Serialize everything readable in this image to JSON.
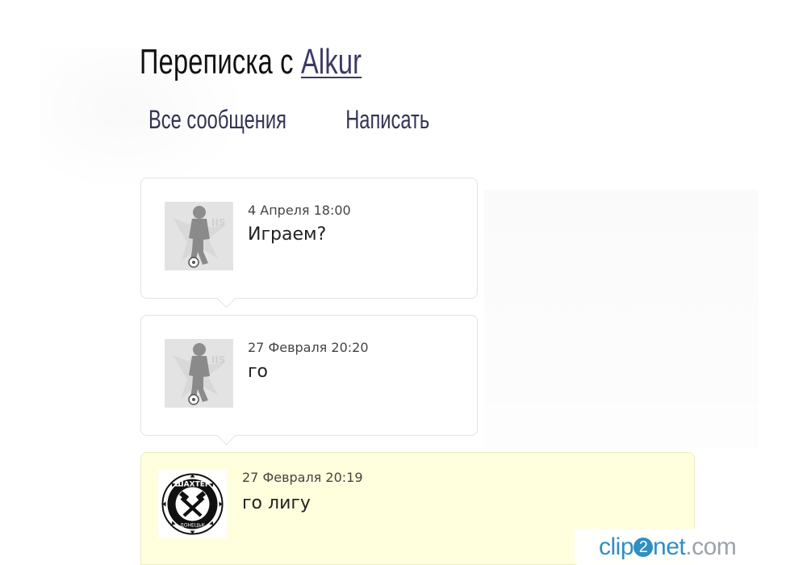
{
  "header": {
    "title_prefix": "Переписка с",
    "partner_name": "Alkur"
  },
  "nav": {
    "all_messages": "Все сообщения",
    "write": "Написать"
  },
  "messages": [
    {
      "date": "4 Апреля 18:00",
      "text": "Играем?",
      "avatar": "player-silhouette-avatar",
      "mine": false
    },
    {
      "date": "27 Февраля 20:20",
      "text": "го",
      "avatar": "player-silhouette-avatar",
      "mine": false
    },
    {
      "date": "27 Февраля 20:19",
      "text": "го лигу",
      "avatar": "shakhtar-club-logo",
      "mine": true
    }
  ],
  "colors": {
    "own_message_bg": "#ffffdd",
    "bubble_border": "#e2e2e2",
    "link": "#3a3a66",
    "watermark": "#2f8fc2"
  },
  "watermark": {
    "pre": "clip",
    "two": "2",
    "post": "net",
    "domain": ".com"
  }
}
